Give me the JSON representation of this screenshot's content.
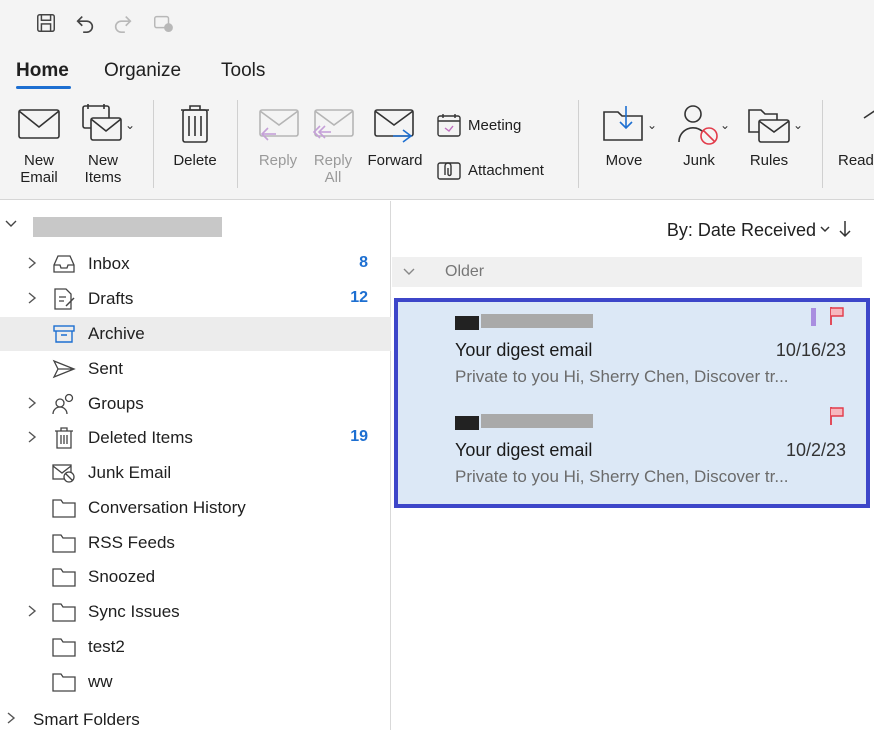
{
  "toolbar": {
    "tabs": [
      {
        "label": "Home"
      },
      {
        "label": "Organize"
      },
      {
        "label": "Tools"
      }
    ]
  },
  "ribbon": {
    "new_email": "New\nEmail",
    "new_items": "New\nItems",
    "delete": "Delete",
    "reply": "Reply",
    "reply_all": "Reply\nAll",
    "forward": "Forward",
    "meeting": "Meeting",
    "attachment": "Attachment",
    "move": "Move",
    "junk": "Junk",
    "rules": "Rules",
    "read": "Read"
  },
  "folders": [
    {
      "label": "Inbox",
      "count": "8",
      "icon": "inbox-icon"
    },
    {
      "label": "Drafts",
      "count": "12",
      "icon": "drafts-icon"
    },
    {
      "label": "Archive",
      "count": "",
      "icon": "archive-icon"
    },
    {
      "label": "Sent",
      "count": "",
      "icon": "sent-icon"
    },
    {
      "label": "Groups",
      "count": "",
      "icon": "groups-icon"
    },
    {
      "label": "Deleted Items",
      "count": "19",
      "icon": "trash-icon"
    },
    {
      "label": "Junk Email",
      "count": "",
      "icon": "junk-icon"
    },
    {
      "label": "Conversation History",
      "count": "",
      "icon": "folder-icon"
    },
    {
      "label": "RSS Feeds",
      "count": "",
      "icon": "folder-icon"
    },
    {
      "label": "Snoozed",
      "count": "",
      "icon": "folder-icon"
    },
    {
      "label": "Sync Issues",
      "count": "",
      "icon": "folder-icon"
    },
    {
      "label": "test2",
      "count": "",
      "icon": "folder-icon"
    },
    {
      "label": "ww",
      "count": "",
      "icon": "folder-icon"
    }
  ],
  "smart_folders": "Smart Folders",
  "message_list": {
    "sort_label": "By: Date Received",
    "group_label": "Older",
    "messages": [
      {
        "subject": "Your digest email",
        "date": "10/16/23",
        "preview": "Private to you Hi, Sherry Chen, Discover tr..."
      },
      {
        "subject": "Your digest email",
        "date": "10/2/23",
        "preview": "Private to you Hi, Sherry Chen, Discover tr..."
      }
    ]
  },
  "colors": {
    "accent": "#1d6fd1",
    "selection_border": "#3d46c9",
    "selection_fill": "#dce8f6",
    "flag": "#e23b4a"
  }
}
